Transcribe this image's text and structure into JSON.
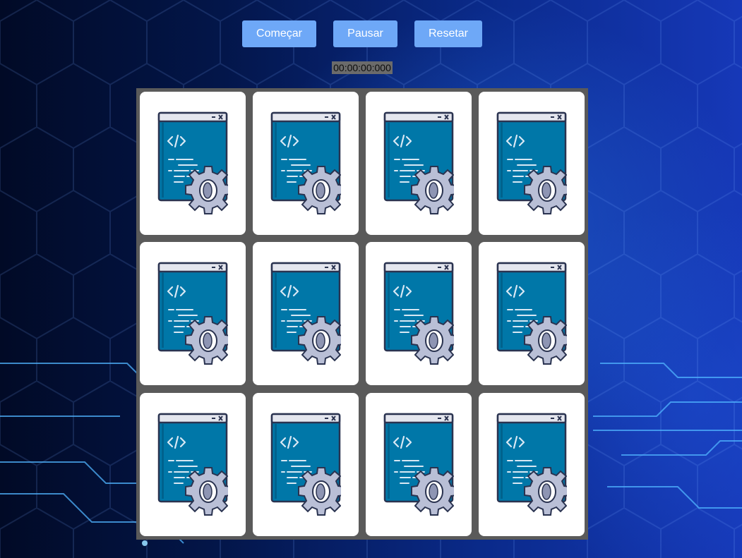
{
  "controls": {
    "start_label": "Começar",
    "pause_label": "Pausar",
    "reset_label": "Resetar"
  },
  "timer": {
    "value": "00:00:00:000"
  },
  "board": {
    "rows": 3,
    "columns": 4,
    "cards": [
      {
        "state": "face-down",
        "icon": "code-window-gear-icon"
      },
      {
        "state": "face-down",
        "icon": "code-window-gear-icon"
      },
      {
        "state": "face-down",
        "icon": "code-window-gear-icon"
      },
      {
        "state": "face-down",
        "icon": "code-window-gear-icon"
      },
      {
        "state": "face-down",
        "icon": "code-window-gear-icon"
      },
      {
        "state": "face-down",
        "icon": "code-window-gear-icon"
      },
      {
        "state": "face-down",
        "icon": "code-window-gear-icon"
      },
      {
        "state": "face-down",
        "icon": "code-window-gear-icon"
      },
      {
        "state": "face-down",
        "icon": "code-window-gear-icon"
      },
      {
        "state": "face-down",
        "icon": "code-window-gear-icon"
      },
      {
        "state": "face-down",
        "icon": "code-window-gear-icon"
      },
      {
        "state": "face-down",
        "icon": "code-window-gear-icon"
      }
    ]
  },
  "colors": {
    "button_bg": "#6ea8f7",
    "board_bg": "#5a5a5a",
    "card_bg": "#ffffff",
    "window_blue": "#0077a8",
    "gear": "#b9bfd6",
    "outline": "#2a3350"
  }
}
